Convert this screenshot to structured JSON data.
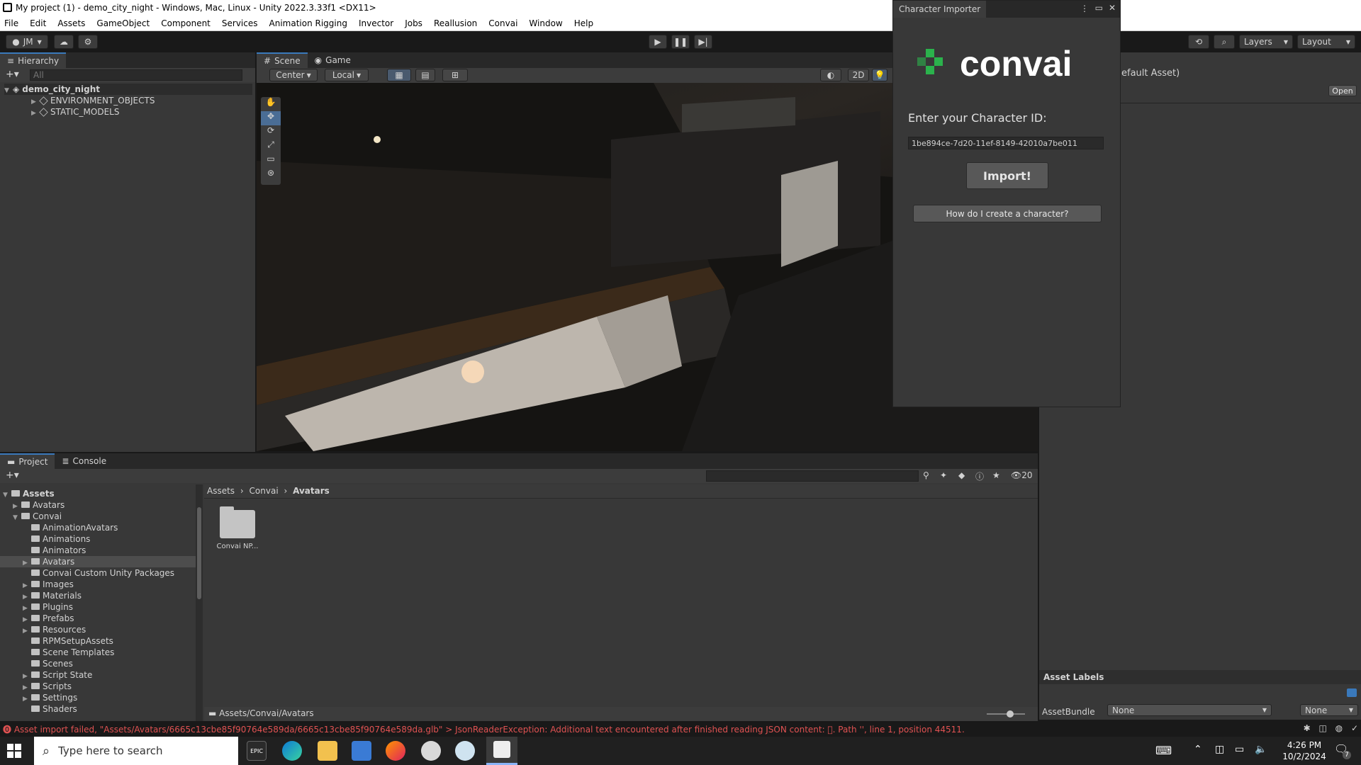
{
  "window": {
    "title": "My project (1) - demo_city_night - Windows, Mac, Linux - Unity 2022.3.33f1 <DX11>",
    "controls": [
      "─",
      "❐",
      "✕"
    ]
  },
  "menu": [
    "File",
    "Edit",
    "Assets",
    "GameObject",
    "Component",
    "Services",
    "Animation Rigging",
    "Invector",
    "Jobs",
    "Reallusion",
    "Convai",
    "Window",
    "Help"
  ],
  "toolbar": {
    "account": "JM",
    "layers": "Layers",
    "layout": "Layout"
  },
  "hierarchy": {
    "tab": "Hierarchy",
    "search_placeholder": "All",
    "scene": "demo_city_night",
    "children": [
      "ENVIRONMENT_OBJECTS",
      "STATIC_MODELS"
    ]
  },
  "scene": {
    "tabs": [
      "Scene",
      "Game"
    ],
    "pivot": "Center",
    "space": "Local",
    "mode_2d": "2D"
  },
  "inspector": {
    "partial_title": "efault Asset)",
    "open_button": "Open",
    "asset_labels": "Asset Labels",
    "assetbundle_label": "AssetBundle",
    "assetbundle_value": "None",
    "variant_value": "None"
  },
  "importer": {
    "tab": "Character Importer",
    "brand": "convai",
    "prompt": "Enter your Character ID:",
    "character_id": "1be894ce-7d20-11ef-8149-42010a7be011",
    "import_button": "Import!",
    "help_button": "How do I create a character?",
    "brand_color": "#2bb24c"
  },
  "project": {
    "tabs": [
      "Project",
      "Console"
    ],
    "breadcrumb": [
      "Assets",
      "Convai",
      "Avatars"
    ],
    "hidden_count": "20",
    "tree": {
      "root": "Assets",
      "level1": [
        "Avatars",
        "Convai"
      ],
      "convai_children": [
        "AnimationAvatars",
        "Animations",
        "Animators",
        "Avatars",
        "Convai Custom Unity Packages",
        "Images",
        "Materials",
        "Plugins",
        "Prefabs",
        "Resources",
        "RPMSetupAssets",
        "Scene Templates",
        "Scenes",
        "Script State",
        "Scripts",
        "Settings",
        "Shaders"
      ]
    },
    "grid_item": "Convai NP...",
    "footer_path": "Assets/Convai/Avatars"
  },
  "status": {
    "error": "Asset import failed, \"Assets/Avatars/6665c13cbe85f90764e589da/6665c13cbe85f90764e589da.glb\" > JsonReaderException: Additional text encountered after finished reading JSON content: \u0000. Path '', line 1, position 44511.",
    "error_color": "#e05252"
  },
  "taskbar": {
    "search_placeholder": "Type here to search",
    "time": "4:26 PM",
    "date": "10/2/2024",
    "notif_count": "7"
  }
}
